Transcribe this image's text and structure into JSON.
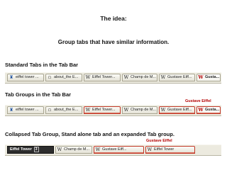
{
  "title": "The idea:",
  "subtitle": "Group tabs that have similar information.",
  "sections": [
    {
      "heading": "Standard Tabs in the Tab Bar",
      "tabs": [
        {
          "label": "eiffel tower ...",
          "icon": "tower-icon"
        },
        {
          "label": "about_the E...",
          "icon": "page-icon"
        },
        {
          "label": "Eiffel Tower...",
          "icon": "wikipedia-icon"
        },
        {
          "label": "Champ de M...",
          "icon": "wikipedia-icon"
        },
        {
          "label": "Gustave Eiff...",
          "icon": "wikipedia-icon"
        },
        {
          "label": "Gusta...",
          "icon": "wikipedia-icon"
        }
      ]
    },
    {
      "heading": "Tab Groups in the Tab Bar",
      "group_label": "Gustave Eiffel",
      "tabs": [
        {
          "label": "eiffel tower ...",
          "icon": "tower-icon"
        },
        {
          "label": "about_the E...",
          "icon": "page-icon"
        },
        {
          "label": "Eiffel Tower...",
          "icon": "wikipedia-icon"
        },
        {
          "label": "Champ de M...",
          "icon": "wikipedia-icon"
        },
        {
          "label": "Gustave Eiff...",
          "icon": "wikipedia-icon"
        },
        {
          "label": "Gusta...",
          "icon": "wikipedia-icon"
        }
      ]
    },
    {
      "heading": "Collapsed Tab Group, Stand alone tab and an expanded Tab group.",
      "group_label": "Gustave Eiffel",
      "collapsed_group": {
        "label": "Eiffel Tower",
        "count": "3"
      },
      "tabs": [
        {
          "label": "Champ de M...",
          "icon": "wikipedia-icon"
        },
        {
          "label": "Gustave Eiff...",
          "icon": "wikipedia-icon"
        },
        {
          "label": "Eiffel Tower",
          "icon": "wikipedia-icon"
        }
      ]
    }
  ]
}
